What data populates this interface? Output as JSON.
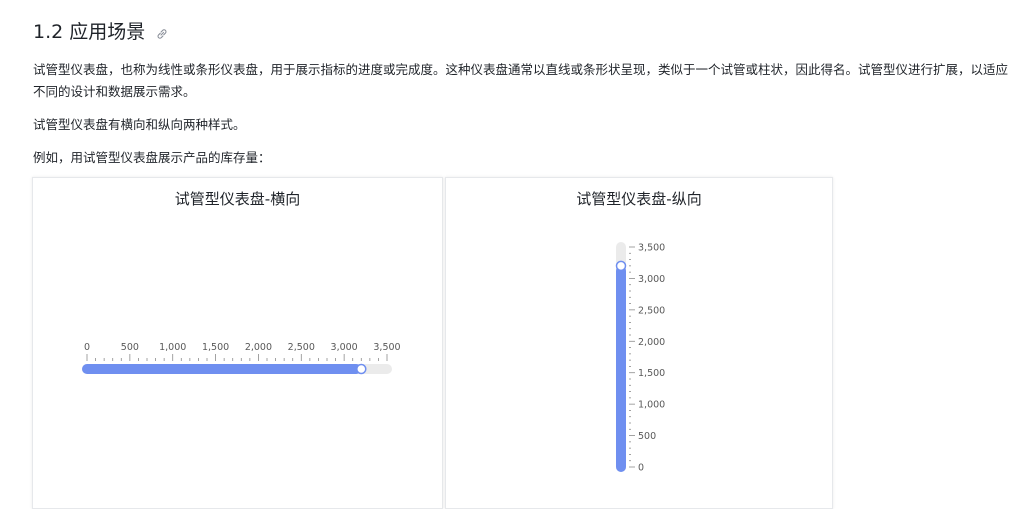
{
  "section": {
    "title": "1.2 应用场景",
    "icon": "link-icon"
  },
  "paragraphs": {
    "p1": "试管型仪表盘，也称为线性或条形仪表盘，用于展示指标的进度或完成度。这种仪表盘通常以直线或条形状呈现，类似于一个试管或柱状，因此得名。试管型仪进行扩展，以适应不同的设计和数据展示需求。",
    "p2": "试管型仪表盘有横向和纵向两种样式。",
    "p3": "例如，用试管型仪表盘展示产品的库存量："
  },
  "chart_data": [
    {
      "type": "bar",
      "title": "试管型仪表盘-横向",
      "orientation": "horizontal",
      "value": 3200,
      "range": [
        0,
        3500
      ],
      "ticks": [
        "0",
        "500",
        "1,000",
        "1,500",
        "2,000",
        "2,500",
        "3,000",
        "3,500"
      ],
      "fill_color": "#6f8ff0",
      "track_color": "#ebebeb"
    },
    {
      "type": "bar",
      "title": "试管型仪表盘-纵向",
      "orientation": "vertical",
      "value": 3200,
      "range": [
        0,
        3500
      ],
      "ticks": [
        "0",
        "500",
        "1,000",
        "1,500",
        "2,000",
        "2,500",
        "3,000",
        "3,500"
      ],
      "fill_color": "#6f8ff0",
      "track_color": "#ebebeb"
    }
  ]
}
